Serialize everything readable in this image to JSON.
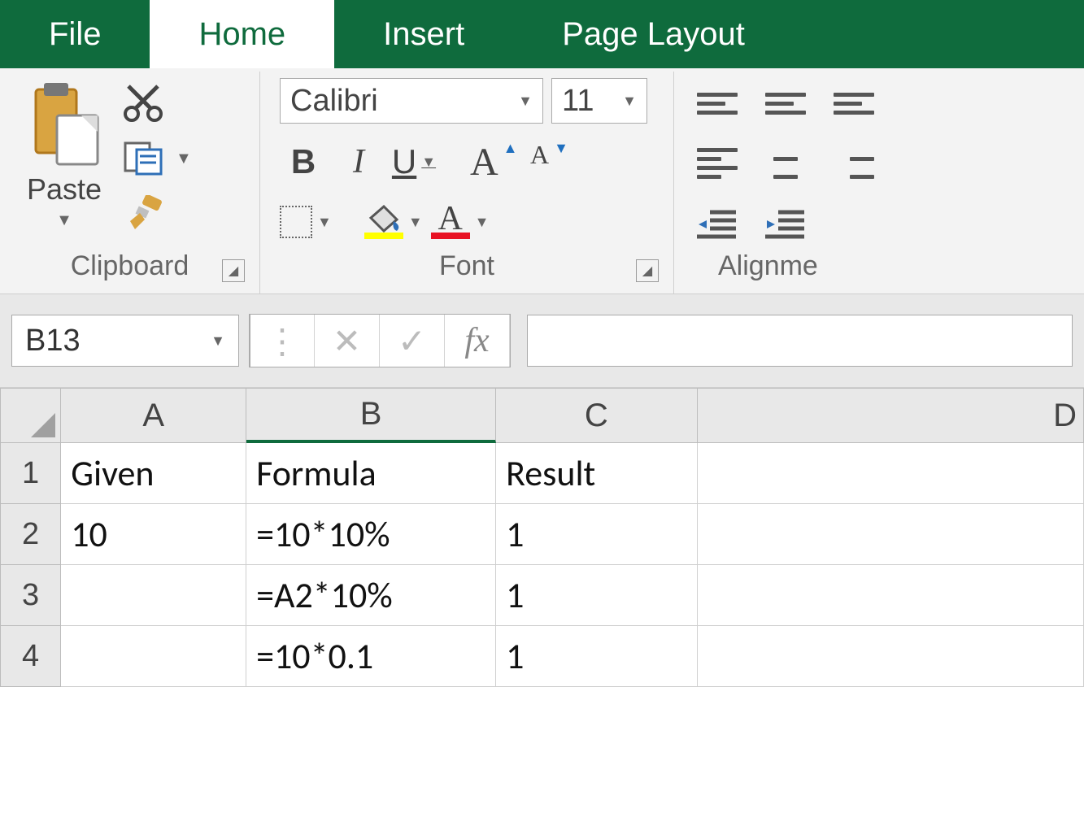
{
  "tabs": {
    "file": "File",
    "home": "Home",
    "insert": "Insert",
    "page_layout": "Page Layout"
  },
  "ribbon": {
    "clipboard": {
      "paste_label": "Paste",
      "group_label": "Clipboard"
    },
    "font": {
      "font_name": "Calibri",
      "font_size": "11",
      "group_label": "Font",
      "bold": "B",
      "italic": "I",
      "underline": "U",
      "increase_A": "A",
      "decrease_A": "A",
      "font_color_A": "A"
    },
    "alignment": {
      "group_label": "Alignme"
    }
  },
  "formula_bar": {
    "name_box": "B13",
    "fx_label": "fx"
  },
  "grid": {
    "columns": [
      "A",
      "B",
      "C",
      "D"
    ],
    "rows": [
      {
        "num": "1",
        "cells": [
          "Given",
          "Formula",
          "Result",
          ""
        ]
      },
      {
        "num": "2",
        "cells": [
          "10",
          "=10*10%",
          "1",
          ""
        ]
      },
      {
        "num": "3",
        "cells": [
          "",
          "=A2*10%",
          "1",
          ""
        ]
      },
      {
        "num": "4",
        "cells": [
          "",
          "=10*0.1",
          "1",
          ""
        ]
      }
    ],
    "selected_column": "B"
  }
}
